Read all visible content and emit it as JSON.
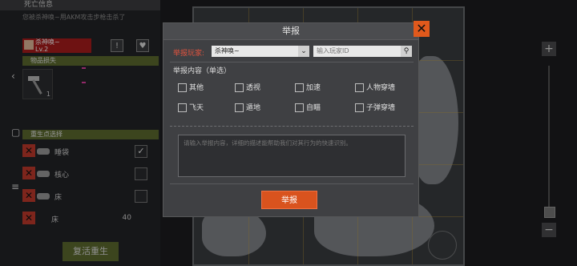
{
  "left_panel": {
    "header": "死亡信息",
    "kill_info": "您被杀神唤~用AKM攻击步枪击杀了",
    "killer_name": "杀神唤~",
    "killer_level": "Lv.2",
    "report_icon": "!",
    "like_icon": "♥",
    "loot_section": "物品损失",
    "loot_count": "1",
    "respawn_section": "重生点选择",
    "respawn_points": [
      {
        "label": "睡袋",
        "checked": true,
        "check": "✓"
      },
      {
        "label": "核心",
        "checked": false,
        "check": ""
      },
      {
        "label": "床",
        "checked": false,
        "check": ""
      },
      {
        "label": "床",
        "cost": "40"
      }
    ],
    "respawn_button": "复活重生"
  },
  "side_icons": {
    "back": "‹",
    "square": "▢",
    "menu": "≡"
  },
  "zoom": {
    "plus": "+",
    "minus": "−"
  },
  "dialog": {
    "title": "举报",
    "close": "✕",
    "player_label": "举报玩家:",
    "player_selected": "杀神唤~",
    "dropdown_arrow": "⌄",
    "id_placeholder": "输入玩家ID",
    "search_icon": "⚲",
    "content_label": "举报内容（单选）",
    "options_row1": [
      "其他",
      "透视",
      "加速",
      "人物穿墙"
    ],
    "options_row2": [
      "飞天",
      "遁地",
      "自瞄",
      "子弹穿墙"
    ],
    "description_placeholder": "请输入举报内容，详细的描述能帮助我们对其行为的快速识别。",
    "submit": "举报"
  },
  "colors": {
    "accent": "#d9531e",
    "danger": "#c0392b",
    "section": "#5c6b2e"
  }
}
